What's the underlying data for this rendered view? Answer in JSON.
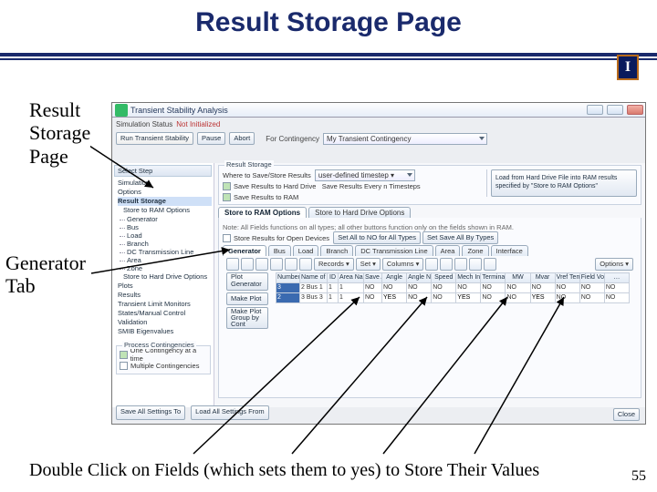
{
  "slide": {
    "title": "Result Storage Page",
    "label1": "Result\nStorage\nPage",
    "label2": "Generator\nTab",
    "footer": "Double Click on Fields (which sets them to yes) to Store Their Values",
    "page": "55",
    "logo": "I"
  },
  "window": {
    "title": "Transient Stability Analysis",
    "simName": "Simulation Status",
    "simVal": "Not Initialized",
    "buttons": {
      "runTS": "Run Transient Stability",
      "pause": "Pause",
      "abort": "Abort",
      "loadHD": "Load from Hard Drive File into RAM results\nspecified by \"Store to RAM Options\""
    },
    "contLbl": "For Contingency",
    "contVal": "My Transient Contingency",
    "tree": {
      "header": "Select Step",
      "items": [
        "Simulation",
        "Options",
        "Result Storage",
        "Store to RAM Options",
        "Generator",
        "Bus",
        "Load",
        "Branch",
        "DC Transmission Line",
        "Area",
        "Zone",
        "Store to Hard Drive Options",
        "Plots",
        "Results",
        "Transient Limit Monitors",
        "States/Manual Control",
        "Validation",
        "SMIB Eigenvalues"
      ]
    },
    "panel": {
      "groupLabel": "Result Storage",
      "whereLabel": "Where to Save/Store Results",
      "timestep": "user-defined timestep ▾",
      "saveLog": "Save Results to Hard Drive",
      "saveEvery": "Save Results Every n Timesteps",
      "saveRAM": "Save Results to RAM",
      "optTabs": [
        "Store to RAM Options",
        "Store to Hard Drive Options"
      ],
      "note": "Note: All Fields functions on all types; all other buttons function only on the fields shown in RAM.",
      "storeOpenDev": "Store Results for Open Devices",
      "setNoAll": "Set All to NO for All Types",
      "setSaveAll": "Set Save All By Types",
      "subtabs": [
        "Generator",
        "Bus",
        "Load",
        "Branch",
        "DC Transmission Line",
        "Area",
        "Zone",
        "Interface"
      ],
      "tbtext": [
        "Records ▾",
        "Set ▾",
        "Columns ▾",
        "",
        "",
        "",
        "",
        "",
        "",
        "Options ▾"
      ],
      "plotbtns": [
        "Plot Generator",
        "",
        "Make Plot",
        "",
        "Make Plot Group by Cont"
      ],
      "headers": [
        "Number of Bus",
        "Name of Bus",
        "ID",
        "Area Name of Gen",
        "Save All",
        "Angle",
        "Angle No Shift",
        "Speed",
        "Mech Input",
        "Terminal",
        "MW",
        "Mvar",
        "Vref Terminal",
        "Field Voltage",
        "…"
      ],
      "rows": [
        [
          "3",
          "2 Bus 1",
          "1",
          "1",
          "NO",
          "NO",
          "NO",
          "NO",
          "NO",
          "NO",
          "NO",
          "NO",
          "NO",
          "NO",
          "NO"
        ],
        [
          "2",
          "3 Bus 3",
          "1",
          "1",
          "NO",
          "YES",
          "NO",
          "NO",
          "YES",
          "NO",
          "NO",
          "YES",
          "NO",
          "NO",
          "NO"
        ]
      ]
    },
    "processCont": "Process Contingencies",
    "oneAtTime": "One Contingency at a time",
    "multiple": "Multiple Contingencies",
    "saveAllBtn": "Save All Settings To",
    "loadAllBtn": "Load All Settings From",
    "close": "Close"
  }
}
